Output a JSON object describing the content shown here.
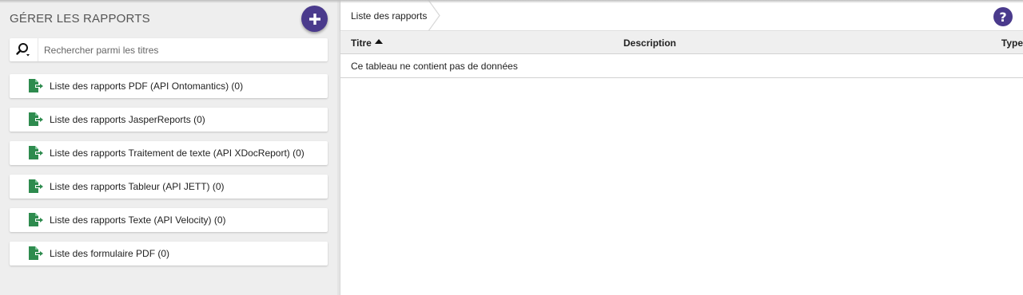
{
  "sidebar": {
    "title": "GÉRER LES RAPPORTS",
    "add_button_icon": "plus-icon",
    "search": {
      "placeholder": "Rechercher parmi les titres",
      "value": "",
      "icon": "search-icon"
    },
    "items": [
      {
        "label": "Liste des rapports PDF (API Ontomantics) (0)",
        "icon": "file-export-icon"
      },
      {
        "label": "Liste des rapports JasperReports (0)",
        "icon": "file-export-icon"
      },
      {
        "label": "Liste des rapports Traitement de texte (API XDocReport) (0)",
        "icon": "file-export-icon"
      },
      {
        "label": "Liste des rapports Tableur (API JETT) (0)",
        "icon": "file-export-icon"
      },
      {
        "label": "Liste des rapports Texte (API Velocity) (0)",
        "icon": "file-export-icon"
      },
      {
        "label": "Liste des formulaire PDF (0)",
        "icon": "file-export-icon"
      }
    ]
  },
  "main": {
    "breadcrumb": [
      "Liste des rapports"
    ],
    "help_icon": "help-icon",
    "table": {
      "columns": [
        "Titre",
        "Description",
        "Type"
      ],
      "sort_column": "Titre",
      "sort_direction": "ascending",
      "empty_message": "Ce tableau ne contient pas de données",
      "rows": []
    }
  },
  "colors": {
    "accent": "#4a3a8c",
    "file_icon": "#2e8b4e",
    "sidebar_bg": "#eeeeee"
  }
}
